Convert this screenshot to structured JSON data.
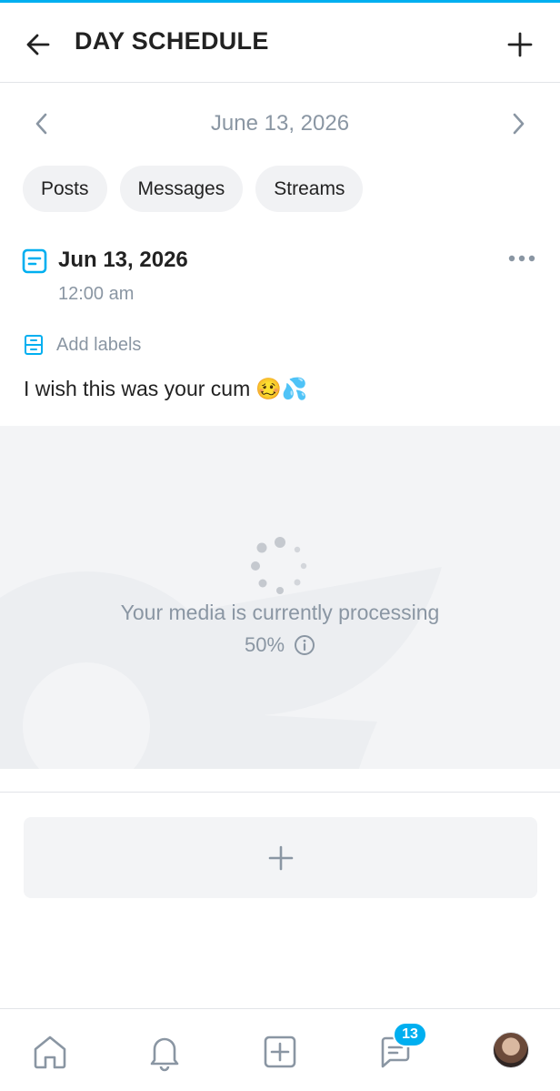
{
  "header": {
    "title": "DAY SCHEDULE"
  },
  "date_nav": {
    "label": "June 13, 2026"
  },
  "filters": [
    {
      "label": "Posts"
    },
    {
      "label": "Messages"
    },
    {
      "label": "Streams"
    }
  ],
  "post": {
    "date": "Jun 13, 2026",
    "time": "12:00 am",
    "add_labels": "Add labels",
    "text": "I wish this was your cum",
    "emoji": "🥴💦",
    "media": {
      "status": "Your media is currently processing",
      "progress": "50%"
    }
  },
  "bottom_nav": {
    "items": [
      "home-icon",
      "bell-icon",
      "plus-square-icon",
      "messages-icon",
      "avatar"
    ],
    "message_badge": "13"
  },
  "colors": {
    "accent": "#00aff0",
    "muted": "#8a96a3"
  }
}
